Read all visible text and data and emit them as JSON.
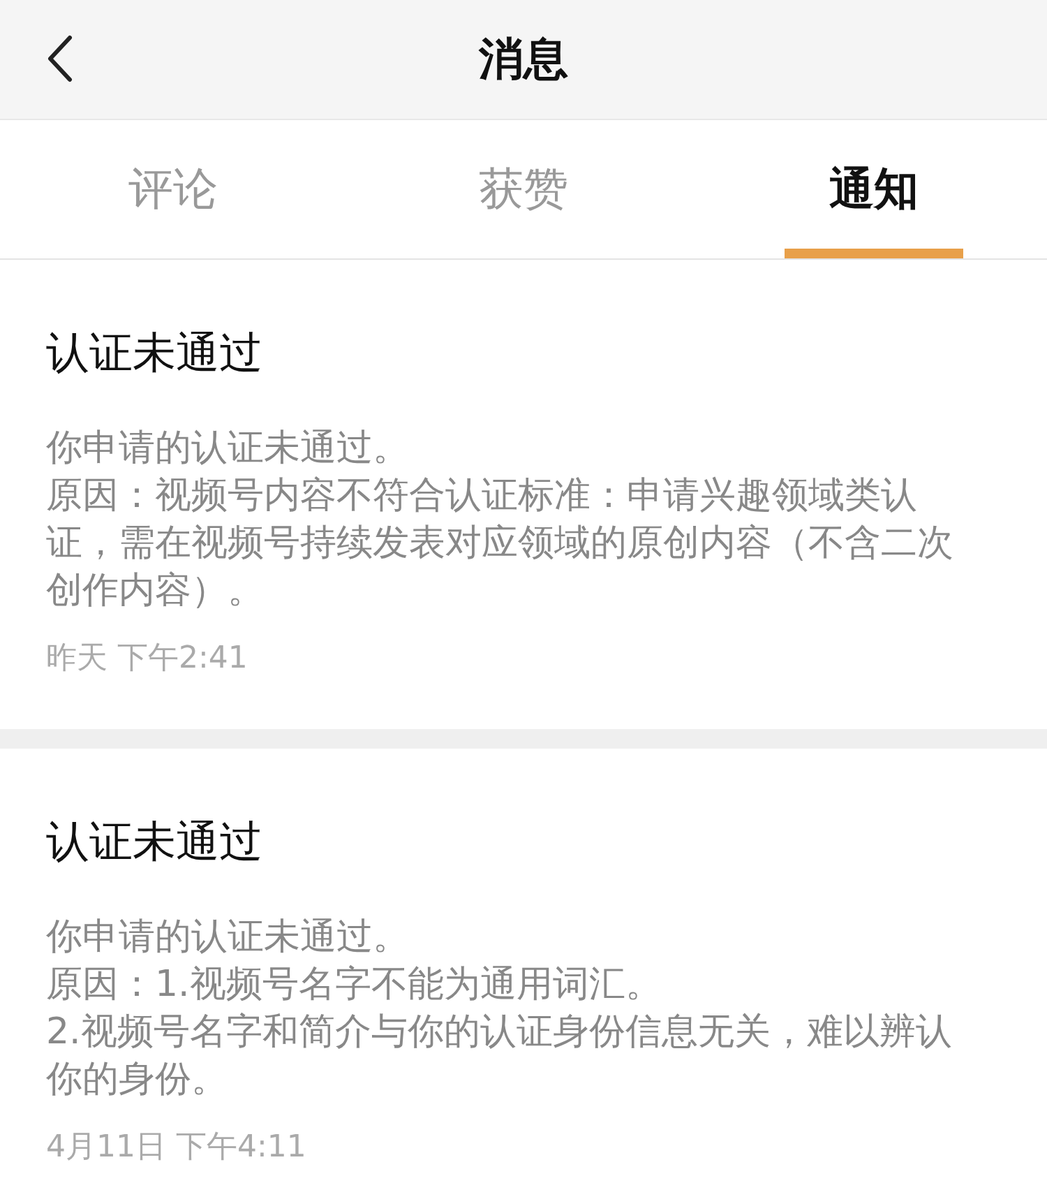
{
  "header": {
    "title": "消息"
  },
  "tabs": [
    {
      "label": "评论",
      "selected": false
    },
    {
      "label": "获赞",
      "selected": false
    },
    {
      "label": "通知",
      "selected": true
    }
  ],
  "notifications": [
    {
      "title": "认证未通过",
      "body": [
        "你申请的认证未通过。",
        "原因：视频号内容不符合认证标准：申请兴趣领域类认证，需在视频号持续发表对应领域的原创内容（不含二次创作内容）。"
      ],
      "time": "昨天 下午2:41"
    },
    {
      "title": "认证未通过",
      "body": [
        "你申请的认证未通过。",
        "原因：1.视频号名字不能为通用词汇。",
        "2.视频号名字和简介与你的认证身份信息无关，难以辨认你的身份。"
      ],
      "time": "4月11日 下午4:11"
    }
  ]
}
